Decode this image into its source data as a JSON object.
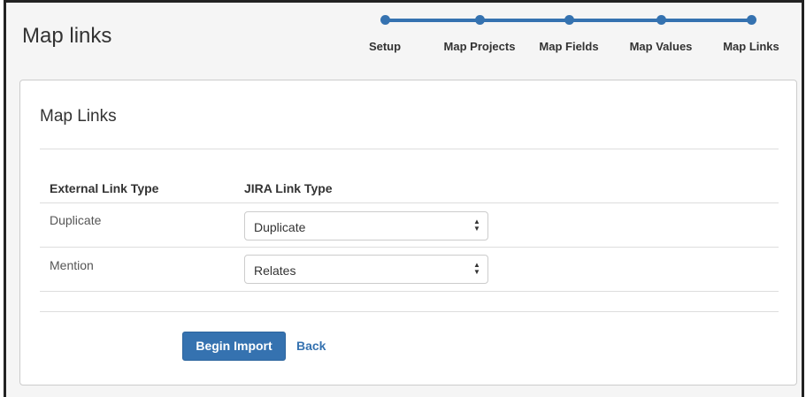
{
  "page": {
    "title": "Map links"
  },
  "steps": [
    {
      "label": "Setup"
    },
    {
      "label": "Map Projects"
    },
    {
      "label": "Map Fields"
    },
    {
      "label": "Map Values"
    },
    {
      "label": "Map Links"
    }
  ],
  "panel": {
    "title": "Map Links",
    "columns": {
      "external": "External Link Type",
      "jira": "JIRA Link Type"
    },
    "rows": [
      {
        "external": "Duplicate",
        "jira": "Duplicate"
      },
      {
        "external": "Mention",
        "jira": "Relates"
      }
    ],
    "actions": {
      "begin_import": "Begin Import",
      "back": "Back"
    }
  },
  "colors": {
    "accent": "#3572b0"
  }
}
